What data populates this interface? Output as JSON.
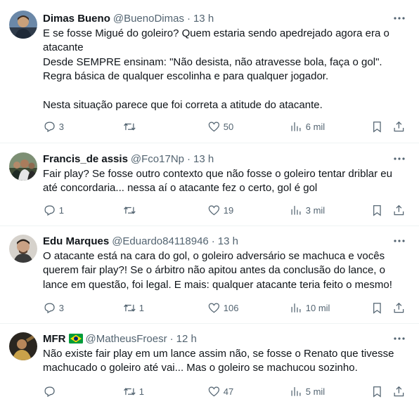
{
  "tweets": [
    {
      "name": "Dimas Bueno",
      "handle": "@BuenoDimas",
      "time": "13 h",
      "lines": [
        "E se fosse Migué do goleiro? Quem estaria sendo apedrejado agora era o",
        "atacante",
        "Desde SEMPRE ensinam: \"Não desista, não atravesse bola, faça o gol\".",
        "Regra básica de qualquer escolinha e para qualquer jogador.",
        "",
        "Nesta situação parece que foi correta a atitude do atacante."
      ],
      "replies": "3",
      "retweets": "",
      "likes": "50",
      "views": "6 mil",
      "avatar_icon": "person-photo-icon"
    },
    {
      "name": "Francis_de assis",
      "handle": "@Fco17Np",
      "time": "13 h",
      "lines": [
        "Fair play? Se fosse outro contexto que não fosse o goleiro tentar driblar eu",
        "até concordaria... nessa  aí o atacante fez o certo, gol é gol"
      ],
      "replies": "1",
      "retweets": "",
      "likes": "19",
      "views": "3 mil",
      "avatar_icon": "crowd-photo-icon"
    },
    {
      "name": "Edu Marques",
      "handle": "@Eduardo84118946",
      "time": "13 h",
      "lines": [
        "O atacante está na cara do gol, o goleiro adversário se machuca e vocês",
        "querem fair play?! Se o árbitro não apitou antes da conclusão do lance, o",
        "lance em questão, foi legal. E mais: qualquer atacante teria feito o mesmo!"
      ],
      "replies": "3",
      "retweets": "1",
      "likes": "106",
      "views": "10 mil",
      "avatar_icon": "person-photo-icon"
    },
    {
      "name": "MFR",
      "handle": "@MatheusFroesr",
      "time": "12 h",
      "lines": [
        "Não existe fair play em um lance assim não, se fosse o Renato que tivesse",
        "machucado o goleiro até vai... Mas o goleiro se machucou sozinho."
      ],
      "replies": "",
      "retweets": "1",
      "likes": "47",
      "views": "5 mil",
      "avatar_icon": "person-photo-icon",
      "flag_icon": "brazil-flag-icon"
    }
  ],
  "colors": {
    "text": "#0f1419",
    "secondary": "#536471",
    "divider": "#eff3f4",
    "flag_green": "#009c3b",
    "flag_yellow": "#ffdf00",
    "flag_blue": "#002776"
  },
  "icons": {
    "more": "more-dots-icon",
    "reply": "reply-bubble-icon",
    "retweet": "retweet-icon",
    "like": "heart-icon",
    "views": "views-bars-icon",
    "bookmark": "bookmark-icon",
    "share": "share-upload-icon"
  }
}
